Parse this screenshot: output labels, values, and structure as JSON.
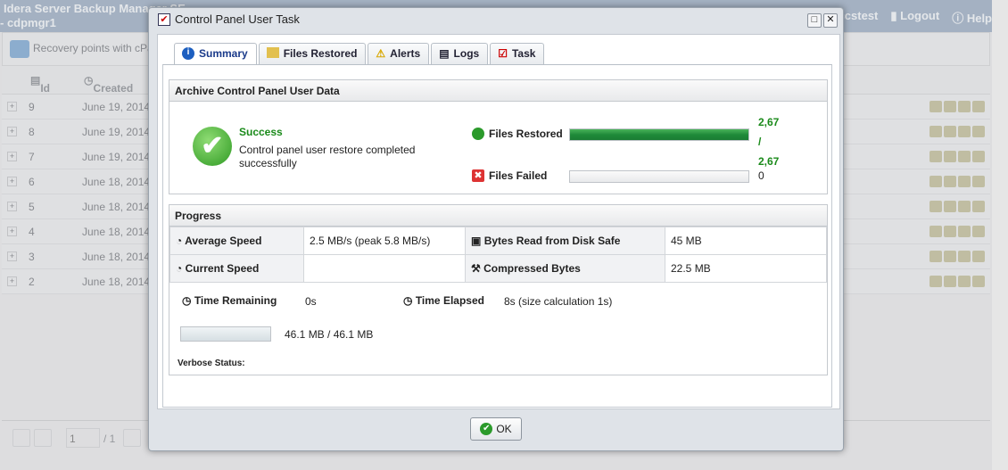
{
  "app": {
    "title": "Idera Server Backup Manager SE",
    "subtitle": "- cdpmgr1",
    "user": "ccstest",
    "logout": "Logout",
    "help": "Help"
  },
  "toolbar": {
    "title": "Recovery points with cPanel"
  },
  "grid": {
    "headers": [
      "Id",
      "Created On"
    ],
    "rows": [
      {
        "id": "9",
        "created": "June 19, 2014"
      },
      {
        "id": "8",
        "created": "June 19, 2014"
      },
      {
        "id": "7",
        "created": "June 19, 2014"
      },
      {
        "id": "6",
        "created": "June 18, 2014"
      },
      {
        "id": "5",
        "created": "June 18, 2014"
      },
      {
        "id": "4",
        "created": "June 18, 2014"
      },
      {
        "id": "3",
        "created": "June 18, 2014"
      },
      {
        "id": "2",
        "created": "June 18, 2014"
      }
    ]
  },
  "pager": {
    "page": "1",
    "of": "/ 1"
  },
  "modal": {
    "title": "Control Panel User Task",
    "tabs": [
      "Summary",
      "Files Restored",
      "Alerts",
      "Logs",
      "Task"
    ],
    "archive": {
      "heading": "Archive Control Panel User Data",
      "status": "Success",
      "message": "Control panel user restore completed successfully",
      "files_restored_label": "Files Restored",
      "files_restored_value": "2,67",
      "files_restored_sep": "/",
      "files_restored_total": "2,67",
      "files_restored_progress": 1.0,
      "files_failed_label": "Files Failed",
      "files_failed_value": "0",
      "files_failed_progress": 0
    },
    "progress": {
      "heading": "Progress",
      "avg_speed_label": "Average Speed",
      "avg_speed": "2.5 MB/s (peak 5.8 MB/s)",
      "bytes_read_label": "Bytes Read from Disk Safe",
      "bytes_read": "45 MB",
      "cur_speed_label": "Current Speed",
      "cur_speed": "",
      "compressed_label": "Compressed Bytes",
      "compressed": "22.5 MB",
      "remaining_label": "Time Remaining",
      "remaining": "0s",
      "elapsed_label": "Time Elapsed",
      "elapsed": "8s (size calculation 1s)",
      "total": "46.1 MB / 46.1 MB",
      "total_progress": 1.0,
      "verbose_label": "Verbose Status:"
    },
    "ok": "OK"
  },
  "colors": {
    "success": "#1a8a1a",
    "bar": "#1f8a3a"
  }
}
